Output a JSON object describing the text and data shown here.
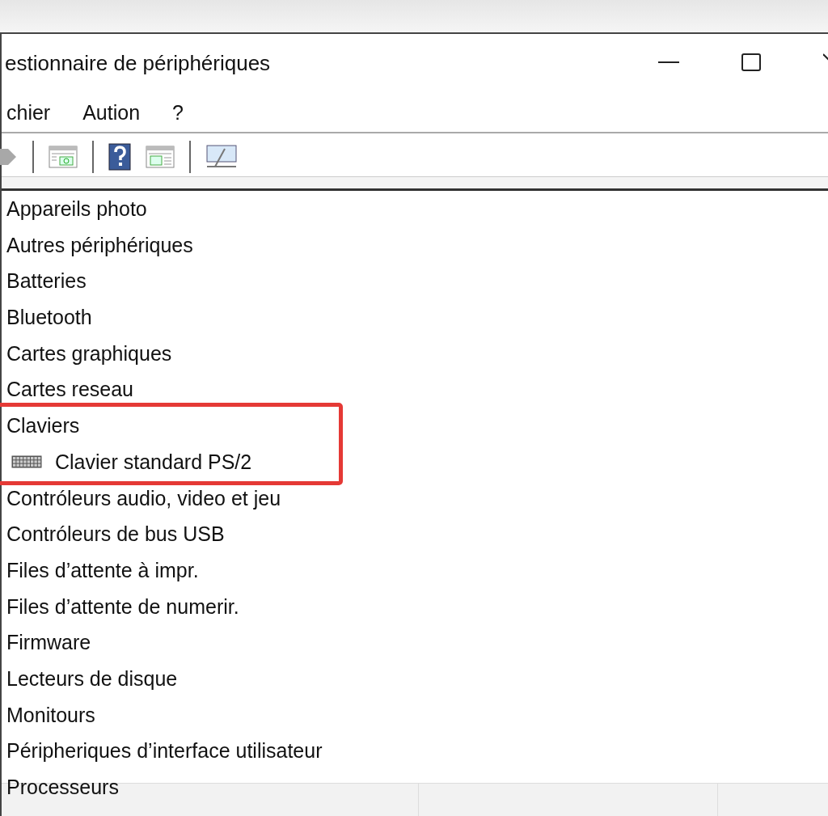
{
  "window": {
    "title": "estionnaire de périphériques"
  },
  "menu": [
    {
      "label": "chier"
    },
    {
      "label": "Aution"
    },
    {
      "label": "?"
    }
  ],
  "toolbar": [
    {
      "kind": "forward"
    },
    {
      "kind": "separator"
    },
    {
      "kind": "properties"
    },
    {
      "kind": "separator"
    },
    {
      "kind": "help"
    },
    {
      "kind": "driver"
    },
    {
      "kind": "separator"
    },
    {
      "kind": "monitor"
    }
  ],
  "tree": [
    {
      "label": "Appareils photo",
      "highlighted": false
    },
    {
      "label": "Autres périphériques",
      "highlighted": false
    },
    {
      "label": "Batteries",
      "highlighted": false
    },
    {
      "label": "Bluetooth",
      "highlighted": false
    },
    {
      "label": "Cartes graphiques",
      "highlighted": false
    },
    {
      "label": "Cartes reseau",
      "highlighted": false
    },
    {
      "label": "Claviers",
      "highlighted": true,
      "children": [
        {
          "label": "Clavier standard PS/2",
          "kind": "keyboard"
        }
      ]
    },
    {
      "label": "Contróleurs audio, video et jeu",
      "highlighted": false
    },
    {
      "label": "Contróleurs de bus USB",
      "highlighted": false
    },
    {
      "label": "Files d’attente à impr.",
      "highlighted": false
    },
    {
      "label": "Files d’attente de numerir.",
      "highlighted": false
    },
    {
      "label": "Firmware",
      "highlighted": false
    },
    {
      "label": "Lecteurs de disque",
      "highlighted": false
    },
    {
      "label": "Monitours",
      "highlighted": false
    },
    {
      "label": "Péripheriques d’interface utilisateur",
      "highlighted": false
    },
    {
      "label": "Processeurs",
      "highlighted": false
    }
  ]
}
